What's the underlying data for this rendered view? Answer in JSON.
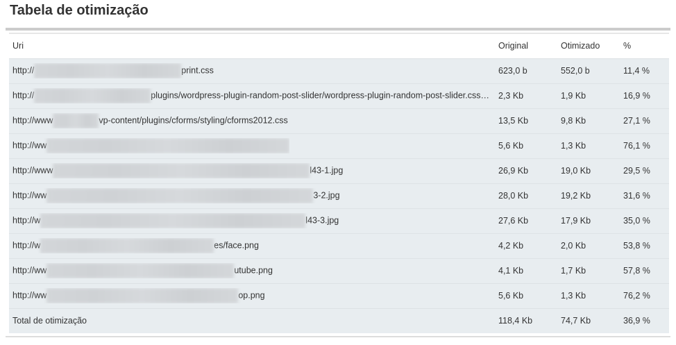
{
  "title": "Tabela de otimização",
  "columns": {
    "uri": "Uri",
    "original": "Original",
    "optimized": "Otimizado",
    "percent": "%"
  },
  "rows": [
    {
      "prefix": "http://",
      "suffix": "print.css",
      "original": "623,0 b",
      "optimized": "552,0 b",
      "percent": "11,4 %"
    },
    {
      "prefix": "http://",
      "suffix": "plugins/wordpress-plugin-random-post-slider/wordpress-plugin-random-post-slider.css…",
      "original": "2,3 Kb",
      "optimized": "1,9 Kb",
      "percent": "16,9 %"
    },
    {
      "prefix": "http://www",
      "suffix": "vp-content/plugins/cforms/styling/cforms2012.css",
      "original": "13,5 Kb",
      "optimized": "9,8 Kb",
      "percent": "27,1 %"
    },
    {
      "prefix": "http://ww",
      "suffix": "",
      "original": "5,6 Kb",
      "optimized": "1,3 Kb",
      "percent": "76,1 %"
    },
    {
      "prefix": "http://www",
      "suffix": "l43-1.jpg",
      "original": "26,9 Kb",
      "optimized": "19,0 Kb",
      "percent": "29,5 %"
    },
    {
      "prefix": "http://ww",
      "suffix": "3-2.jpg",
      "original": "28,0 Kb",
      "optimized": "19,2 Kb",
      "percent": "31,6 %"
    },
    {
      "prefix": "http://w",
      "suffix": "l43-3.jpg",
      "original": "27,6 Kb",
      "optimized": "17,9 Kb",
      "percent": "35,0 %"
    },
    {
      "prefix": "http://w",
      "suffix": "es/face.png",
      "original": "4,2 Kb",
      "optimized": "2,0 Kb",
      "percent": "53,8 %"
    },
    {
      "prefix": "http://ww",
      "suffix": "utube.png",
      "original": "4,1 Kb",
      "optimized": "1,7 Kb",
      "percent": "57,8 %"
    },
    {
      "prefix": "http://ww",
      "suffix": "op.png",
      "original": "5,6 Kb",
      "optimized": "1,3 Kb",
      "percent": "76,2 %"
    }
  ],
  "total": {
    "label": "Total de otimização",
    "original": "118,4 Kb",
    "optimized": "74,7 Kb",
    "percent": "36,9 %"
  }
}
